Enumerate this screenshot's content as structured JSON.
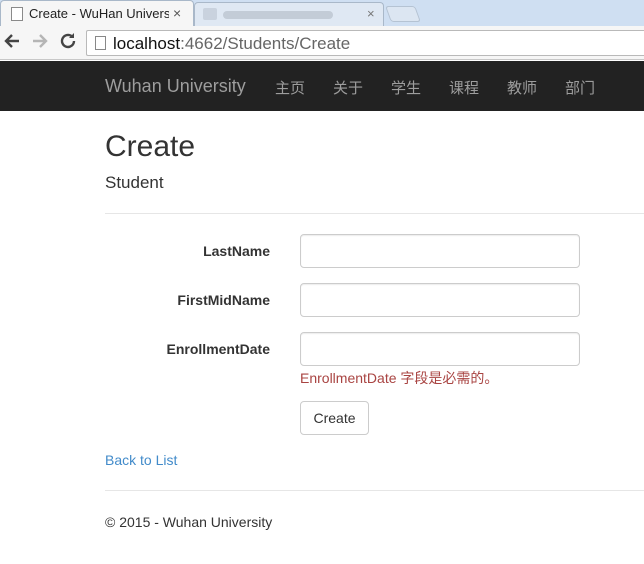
{
  "browser": {
    "active_tab_title": "Create - WuHan Univers",
    "tab_close_glyph": "×",
    "url_host": "localhost",
    "url_rest": ":4662/Students/Create"
  },
  "navbar": {
    "brand": "Wuhan University",
    "items": [
      "主页",
      "关于",
      "学生",
      "课程",
      "教师",
      "部门"
    ]
  },
  "page": {
    "title": "Create",
    "subtitle": "Student"
  },
  "form": {
    "fields": [
      {
        "label": "LastName",
        "value": ""
      },
      {
        "label": "FirstMidName",
        "value": ""
      },
      {
        "label": "EnrollmentDate",
        "value": ""
      }
    ],
    "enrollment_error": "EnrollmentDate 字段是必需的。",
    "submit_label": "Create"
  },
  "back_link": "Back to List",
  "footer": "© 2015 - Wuhan University",
  "colors": {
    "navbar_bg": "#222222",
    "nav_text": "#9d9d9d",
    "link": "#428bca",
    "error": "#a94442"
  },
  "icons": [
    "back-arrow-icon",
    "forward-arrow-icon",
    "reload-icon",
    "page-icon",
    "favicon-icon",
    "tab-close-icon"
  ]
}
